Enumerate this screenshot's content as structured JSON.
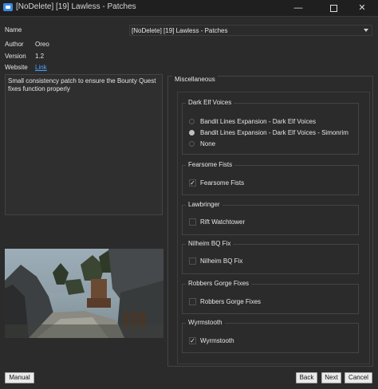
{
  "window": {
    "title": "[NoDelete] [19] Lawless - Patches",
    "icons": {
      "app": "app-icon",
      "minimize": "minimize-icon",
      "maximize": "maximize-icon",
      "close": "close-icon"
    }
  },
  "fields": {
    "name_label": "Name",
    "name_value": "[NoDelete] [19] Lawless - Patches",
    "author_label": "Author",
    "author_value": "Oreo",
    "version_label": "Version",
    "version_value": "1.2",
    "website_label": "Website",
    "website_link": "Link"
  },
  "description": "Small consistency patch to ensure the Bounty Quest fixes function properly",
  "section_title": "Miscellaneous",
  "groups": [
    {
      "title": "Dark Elf Voices",
      "type": "radio",
      "options": [
        {
          "label": "Bandit Lines Expansion - Dark Elf Voices",
          "selected": false
        },
        {
          "label": "Bandit Lines Expansion - Dark Elf Voices - Simonrim",
          "selected": true
        },
        {
          "label": "None",
          "selected": false
        }
      ]
    },
    {
      "title": "Fearsome Fists",
      "type": "checkbox",
      "options": [
        {
          "label": "Fearsome Fists",
          "checked": true,
          "mark": "✓"
        }
      ]
    },
    {
      "title": "Lawbringer",
      "type": "checkbox",
      "options": [
        {
          "label": "Rift Watchtower",
          "checked": false,
          "mark": ""
        }
      ]
    },
    {
      "title": "Nilheim BQ Fix",
      "type": "checkbox",
      "options": [
        {
          "label": "Nilheim BQ Fix",
          "checked": false,
          "mark": ""
        }
      ]
    },
    {
      "title": "Robbers Gorge Fixes",
      "type": "checkbox",
      "options": [
        {
          "label": "Robbers Gorge Fixes",
          "checked": false,
          "mark": ""
        }
      ]
    },
    {
      "title": "Wyrmstooth",
      "type": "checkbox",
      "options": [
        {
          "label": "Wyrmstooth",
          "checked": true,
          "mark": "✓"
        }
      ]
    }
  ],
  "buttons": {
    "manual": "Manual",
    "back": "Back",
    "next": "Next",
    "cancel": "Cancel"
  },
  "colors": {
    "background": "#2b2b2b",
    "link": "#4aa3ff",
    "accent": "#3b8be0"
  }
}
